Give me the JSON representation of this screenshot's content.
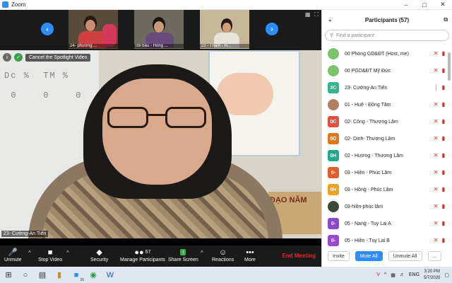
{
  "window": {
    "title": "Zoom"
  },
  "gallery": {
    "thumbnails": [
      {
        "label": "24- phương ..."
      },
      {
        "label": "09-Sáu - Hồng ..."
      },
      {
        "label": "22 - Thắm - H..."
      }
    ]
  },
  "spotlight": {
    "cancel_label": "Cancel the Spotlight Video",
    "speaker_name": "23- Cường-An Tiến",
    "board_text": "Dc %  TM %\n 0    0    0",
    "sign_text": "ĐẠO NĂM"
  },
  "toolbar": {
    "unmute": "Unmute",
    "stop_video": "Stop Video",
    "security": "Security",
    "manage_participants": "Manage Participants",
    "participant_count": "57",
    "share_screen": "Share Screen",
    "reactions": "Reactions",
    "more": "More",
    "end_meeting": "End Meeting"
  },
  "panel": {
    "title": "Participants (57)",
    "search_placeholder": "Find a participant",
    "participants": [
      {
        "name": "00 Phòng GD&ĐT (Host, me)",
        "avatar": "",
        "color": "#7cc46a",
        "mic": "muted"
      },
      {
        "name": "00 PGD&ĐT Mỹ Đức",
        "avatar": "",
        "color": "#7cc46a",
        "mic": "muted"
      },
      {
        "name": "23- Cường-An Tiến",
        "avatar": "2C",
        "color": "#2eb88a",
        "mic": "unmuted"
      },
      {
        "name": "01 - Huệ - Đồng Tâm",
        "avatar": "",
        "color": "#b08060",
        "mic": "muted"
      },
      {
        "name": "02- Công - Thượng Lâm",
        "avatar": "0C",
        "color": "#e0503c",
        "mic": "muted"
      },
      {
        "name": "02- Dinh- Thượng Lâm",
        "avatar": "0D",
        "color": "#e07a1c",
        "mic": "muted"
      },
      {
        "name": "02 - Hương - Thượng Lâm",
        "avatar": "0H",
        "color": "#1eaa8c",
        "mic": "muted"
      },
      {
        "name": "03 - Hiền - Phúc Lâm",
        "avatar": "0-",
        "color": "#e0602c",
        "mic": "muted"
      },
      {
        "name": "03 - Hồng - Phúc Lâm",
        "avatar": "0H",
        "color": "#f0a020",
        "mic": "muted"
      },
      {
        "name": "03-hiền-phúc lâm",
        "avatar": "",
        "color": "#3a4a3a",
        "mic": "muted"
      },
      {
        "name": "05 - Nang - Tuy Lai A",
        "avatar": "0-",
        "color": "#8a4ad0",
        "mic": "muted"
      },
      {
        "name": "05 - Hiền - Tuy Lai B",
        "avatar": "0-",
        "color": "#9a4ad0",
        "mic": "muted"
      }
    ],
    "buttons": {
      "invite": "Invite",
      "mute_all": "Mute All",
      "unmute_all": "Unmute All",
      "more": "..."
    }
  },
  "taskbar": {
    "language": "ENG",
    "time": "3:20 PM",
    "date": "5/7/2020",
    "zoom_badge": "25"
  }
}
